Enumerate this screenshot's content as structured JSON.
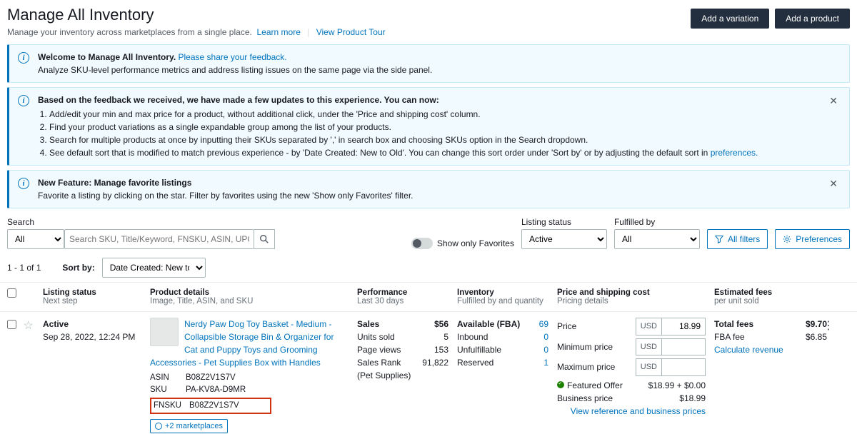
{
  "page": {
    "title": "Manage All Inventory",
    "subtitle": "Manage your inventory across marketplaces from a single place.",
    "learn_more": "Learn more",
    "view_tour": "View Product Tour"
  },
  "header_buttons": {
    "add_variation": "Add a variation",
    "add_product": "Add a product"
  },
  "alert_welcome": {
    "bold": "Welcome to Manage All Inventory.",
    "link": "Please share your feedback.",
    "body": "Analyze SKU-level performance metrics and address listing issues on the same page via the side panel."
  },
  "alert_updates": {
    "lead": "Based on the feedback we received, we have made a few updates to this experience. You can now:",
    "items": [
      "Add/edit your min and max price for a product, without additional click, under the 'Price and shipping cost' column.",
      "Find your product variations as a single expandable group among the list of your products.",
      "Search for multiple products at once by inputting their SKUs separated by ',' in search box and choosing SKUs option in the Search dropdown.",
      "See default sort that is modified to match previous experience - by 'Date Created: New to Old'. You can change this sort order under 'Sort by' or by adjusting the default sort in"
    ],
    "pref_link": "preferences."
  },
  "alert_favorites": {
    "title": "New Feature: Manage favorite listings",
    "body": "Favorite a listing by clicking on the star. Filter by favorites using the new 'Show only Favorites' filter."
  },
  "controls": {
    "search_label": "Search",
    "search_type": "All",
    "search_placeholder": "Search SKU, Title/Keyword, FNSKU, ASIN, UPC/EAN",
    "fav_toggle": "Show only Favorites",
    "listing_status_label": "Listing status",
    "listing_status_value": "Active",
    "fulfilled_label": "Fulfilled by",
    "fulfilled_value": "All",
    "all_filters": "All filters",
    "preferences": "Preferences"
  },
  "sort": {
    "range": "1 - 1 of 1",
    "sort_by_label": "Sort by:",
    "sort_value": "Date Created: New to Old"
  },
  "columns": {
    "status_t": "Listing status",
    "status_s": "Next step",
    "product_t": "Product details",
    "product_s": "Image, Title, ASIN, and SKU",
    "perf_t": "Performance",
    "perf_s": "Last 30 days",
    "inv_t": "Inventory",
    "inv_s": "Fulfilled by and quantity",
    "price_t": "Price and shipping cost",
    "price_s": "Pricing details",
    "fees_t": "Estimated fees",
    "fees_s": "per unit sold"
  },
  "listing": {
    "status": "Active",
    "date": "Sep 28, 2022, 12:24 PM",
    "title": "Nerdy Paw Dog Toy Basket - Medium - Collapsible Storage Bin & Organizer for Cat and Puppy Toys and Grooming Accessories - Pet Supplies Box with Handles",
    "asin_k": "ASIN",
    "asin_v": "B08Z2V1S7V",
    "sku_k": "SKU",
    "sku_v": "PA-KV8A-D9MR",
    "fnsku_k": "FNSKU",
    "fnsku_v": "B08Z2V1S7V",
    "marketplaces": "+2 marketplaces",
    "perf": {
      "sales_k": "Sales",
      "sales_v": "$56",
      "units_k": "Units sold",
      "units_v": "5",
      "views_k": "Page views",
      "views_v": "153",
      "rank_k": "Sales Rank",
      "rank_v": "91,822",
      "rank_cat": "(Pet Supplies)"
    },
    "inv": {
      "avail_k": "Available (FBA)",
      "avail_v": "69",
      "inbound_k": "Inbound",
      "inbound_v": "0",
      "unful_k": "Unfulfillable",
      "unful_v": "0",
      "res_k": "Reserved",
      "res_v": "1"
    },
    "price": {
      "price_k": "Price",
      "currency": "USD",
      "price_v": "18.99",
      "min_k": "Minimum price",
      "max_k": "Maximum price",
      "featured_k": "Featured Offer",
      "featured_v": "$18.99 + $0.00",
      "business_k": "Business price",
      "business_v": "$18.99",
      "ref_link": "View reference and business prices"
    },
    "fees": {
      "total_k": "Total fees",
      "total_v": "$9.70",
      "fba_k": "FBA fee",
      "fba_v": "$6.85",
      "calc_link": "Calculate revenue"
    }
  }
}
